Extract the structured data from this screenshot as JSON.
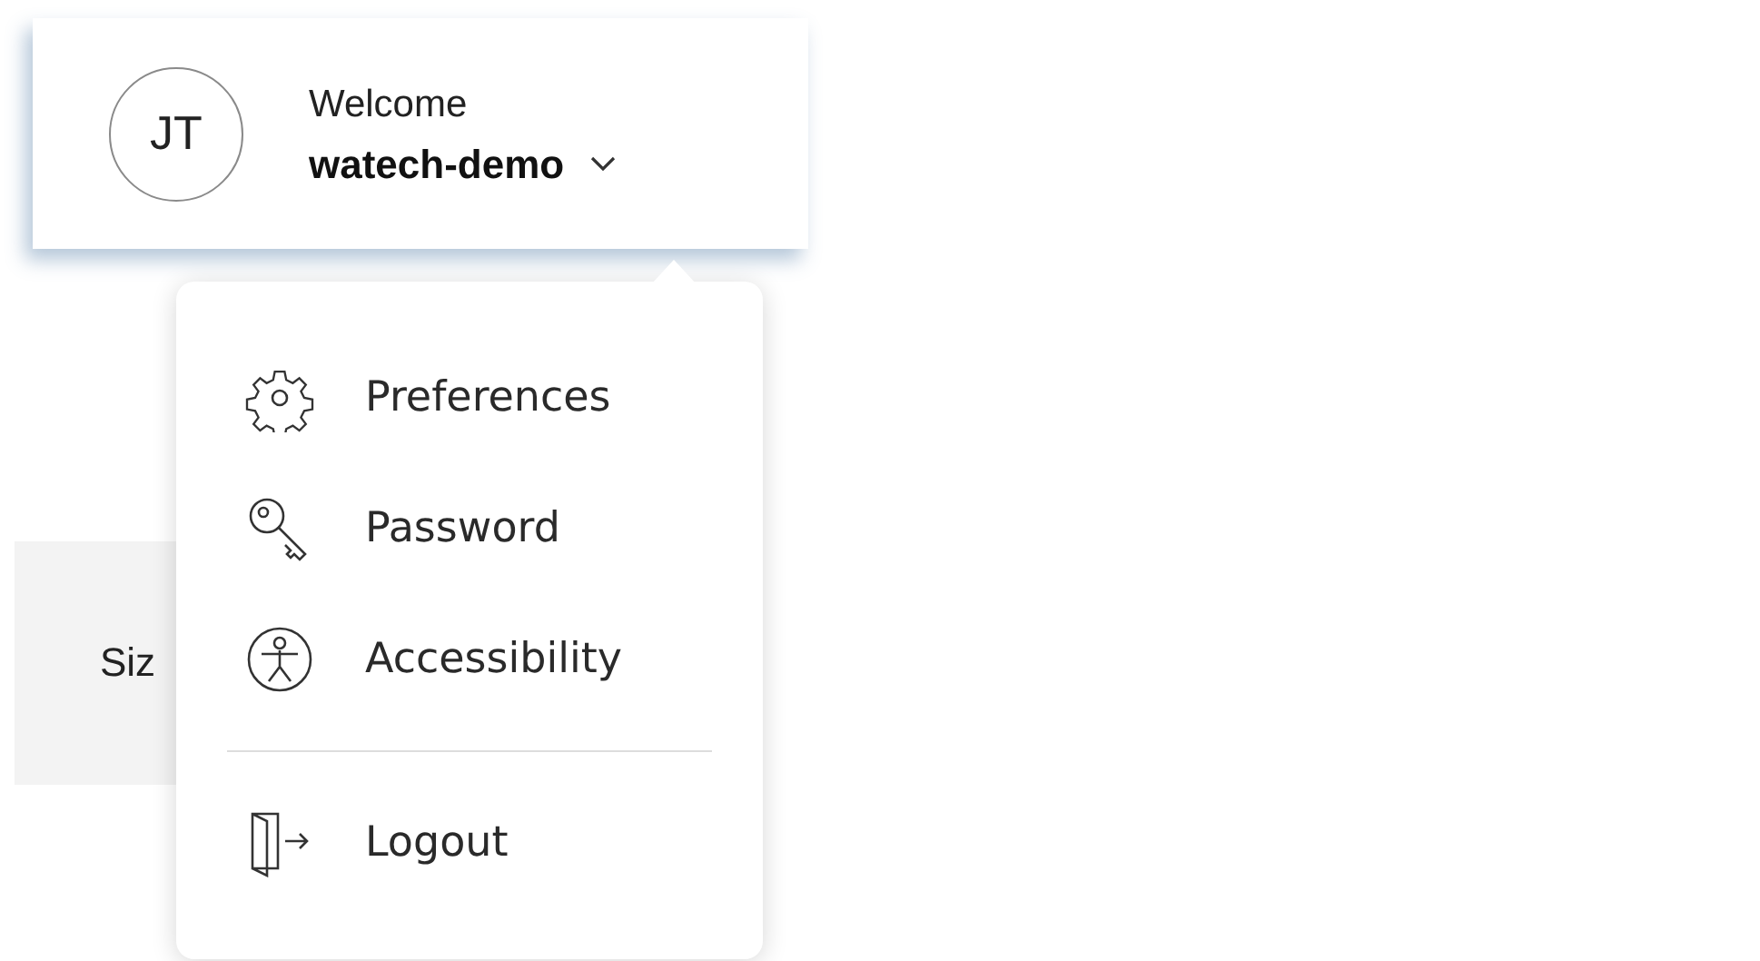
{
  "user_card": {
    "initials": "JT",
    "greeting": "Welcome",
    "username": "watech-demo",
    "expanded": true
  },
  "background_panel": {
    "label": "Siz"
  },
  "menu": {
    "items": [
      {
        "kind": "settings",
        "label": "Preferences"
      },
      {
        "kind": "password",
        "label": "Password"
      },
      {
        "kind": "accessibility",
        "label": "Accessibility"
      },
      {
        "kind": "logout",
        "label": "Logout"
      }
    ]
  }
}
